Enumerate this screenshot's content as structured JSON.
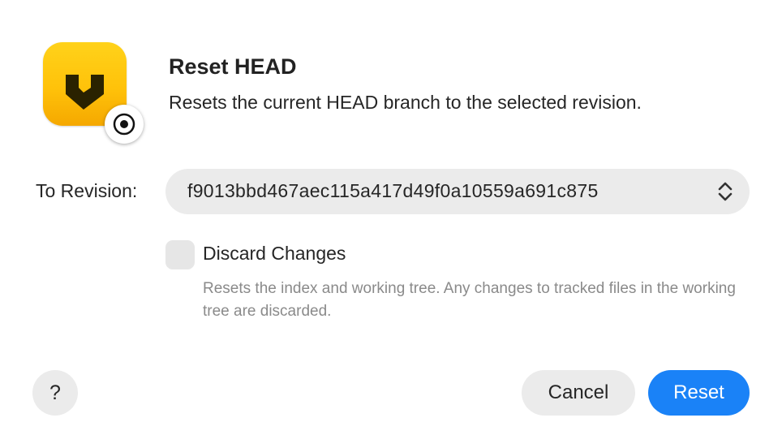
{
  "dialog": {
    "title": "Reset HEAD",
    "subtitle": "Resets the current HEAD branch to the selected revision."
  },
  "icons": {
    "app": "app-logo-icon",
    "badge": "reset-target-icon",
    "select": "chevron-up-down-icon",
    "help": "question-mark-icon"
  },
  "revision": {
    "label": "To Revision:",
    "value": "f9013bbd467aec115a417d49f0a10559a691c875"
  },
  "discard": {
    "label": "Discard Changes",
    "checked": false,
    "description": "Resets the index and working tree. Any changes to tracked files in the working tree are discarded."
  },
  "buttons": {
    "help": "?",
    "cancel": "Cancel",
    "reset": "Reset"
  },
  "colors": {
    "accent": "#1a82f7",
    "app_icon": "#ffc20a"
  }
}
